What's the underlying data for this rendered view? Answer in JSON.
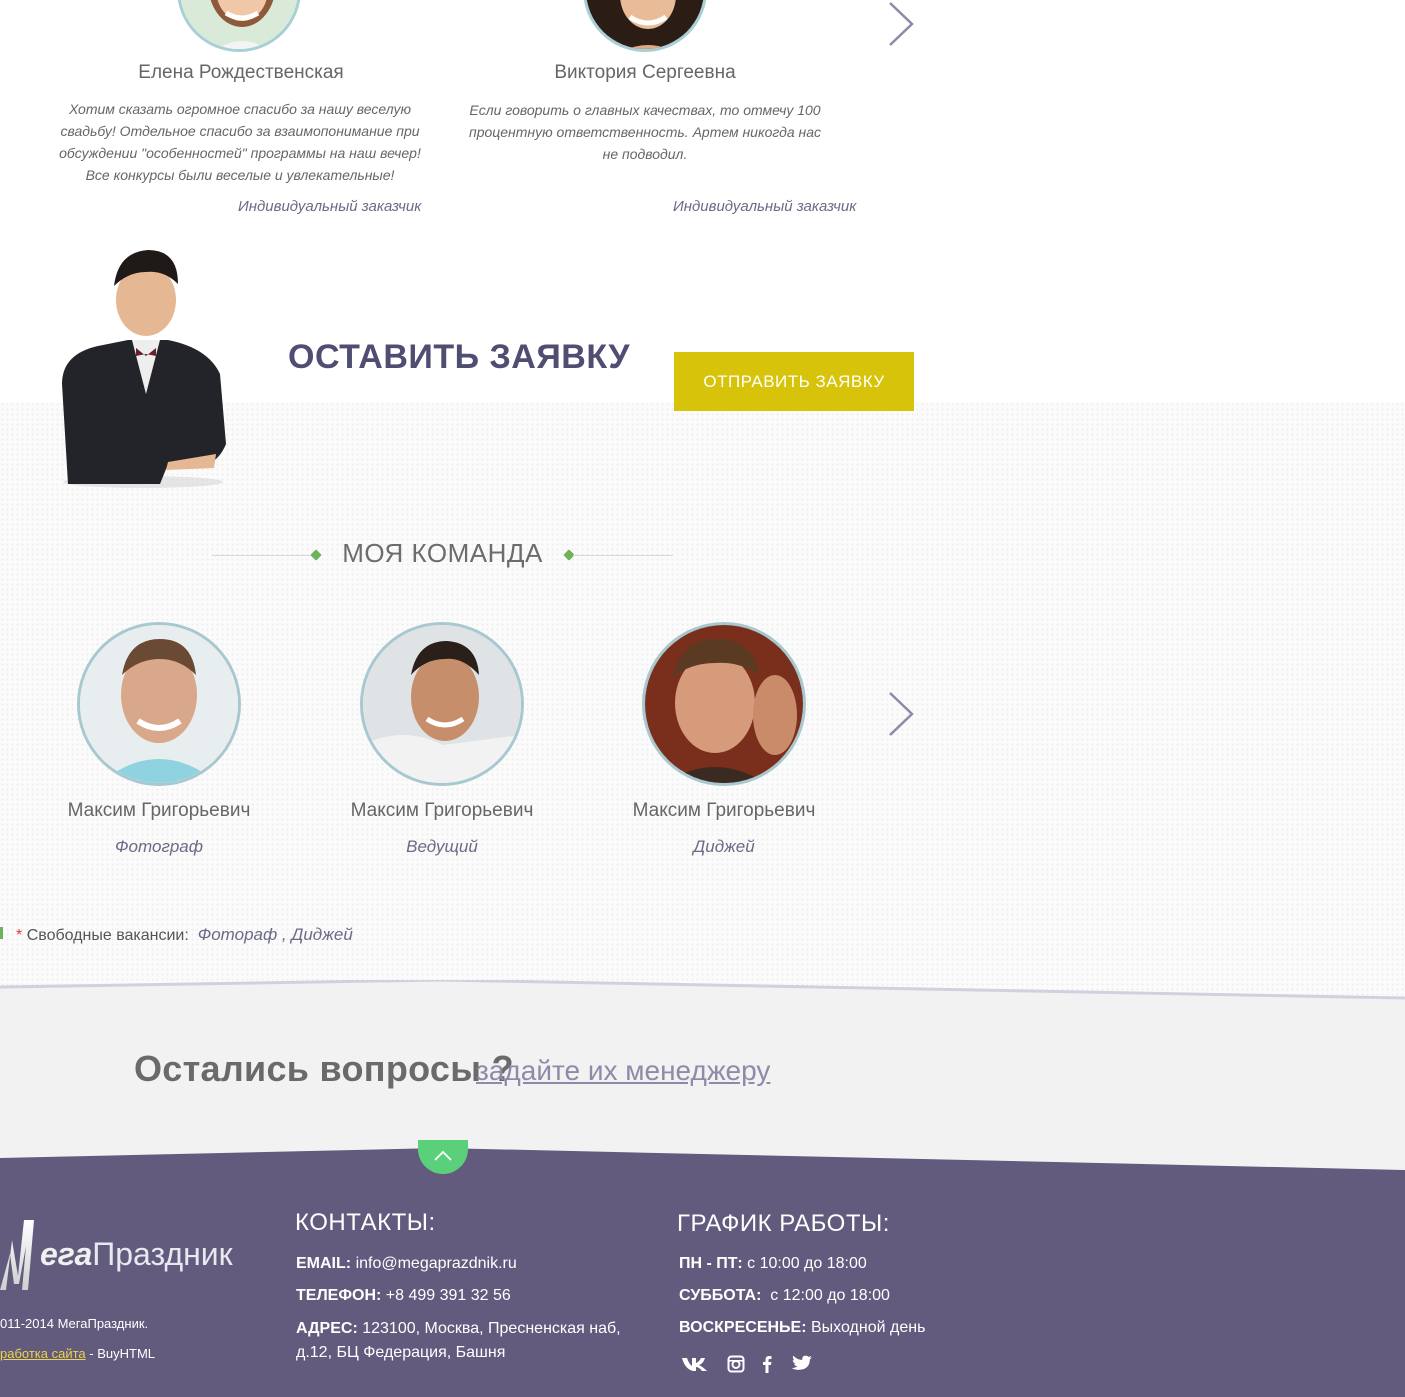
{
  "reviews": {
    "items": [
      {
        "name": "Елена Рождественская",
        "text": "Хотим сказать огромное спасибо за нашу веселую свадьбу! Отдельное спасибо за взаимопонимание при обсуждении \"особенностей\" программы на наш вечер! Все конкурсы были веселые и увлекательные!",
        "author": "Индивидуальный заказчик"
      },
      {
        "name": "Виктория Сергеевна",
        "text": "Если говорить о главных качествах, то отмечу 100 процентную ответственность. Артем никогда нас не подводил.",
        "author": "Индивидуальный заказчик"
      }
    ]
  },
  "cta": {
    "title": "ОСТАВИТЬ ЗАЯВКУ",
    "button": "ОТПРАВИТЬ ЗАЯВКУ"
  },
  "team": {
    "heading": "МОЯ КОМАНДА",
    "members": [
      {
        "name": "Максим Григорьевич",
        "role": "Фотограф"
      },
      {
        "name": "Максим Григорьевич",
        "role": "Ведущий"
      },
      {
        "name": "Максим Григорьевич",
        "role": "Диджей"
      }
    ],
    "vacancies_label": "Свободные вакансии:",
    "vacancies_list": "Фотораф , Диджей",
    "star": "*"
  },
  "questions": {
    "title": "Остались вопросы ?",
    "link": "задайте их менеджеру"
  },
  "footer": {
    "logo_part1": "ега",
    "logo_part2": "Праздник",
    "copyright": "011-2014 МегаПраздник.",
    "dev_link": "работка сайта",
    "dev_suffix": "- BuyHTML",
    "contacts": {
      "title": "КОНТАКТЫ:",
      "email_label": "EMAIL:",
      "email": "info@megaprazdnik.ru",
      "phone_label": "ТЕЛЕФОН:",
      "phone": "+8 499 391 32 56",
      "address_label": "АДРЕС:",
      "address_line1": "123100, Москва, Пресненская наб,",
      "address_line2": "д.12, БЦ Федерация, Башня"
    },
    "schedule": {
      "title": "ГРАФИК РАБОТЫ:",
      "weekdays_label": "ПН - ПТ:",
      "weekdays": "с 10:00 до 18:00",
      "saturday_label": "СУББОТА:",
      "saturday": "с 12:00 до 18:00",
      "sunday_label": "ВОСКРЕСЕНЬЕ:",
      "sunday": "Выходной день"
    },
    "social_icons": [
      "vk-icon",
      "instagram-icon",
      "facebook-icon",
      "twitter-icon"
    ]
  },
  "colors": {
    "accent_yellow": "#d6c30a",
    "footer_purple": "#625b7e",
    "heading_purple": "#4f4d72",
    "green": "#6db35a",
    "to_top_green": "#5bd07a"
  }
}
